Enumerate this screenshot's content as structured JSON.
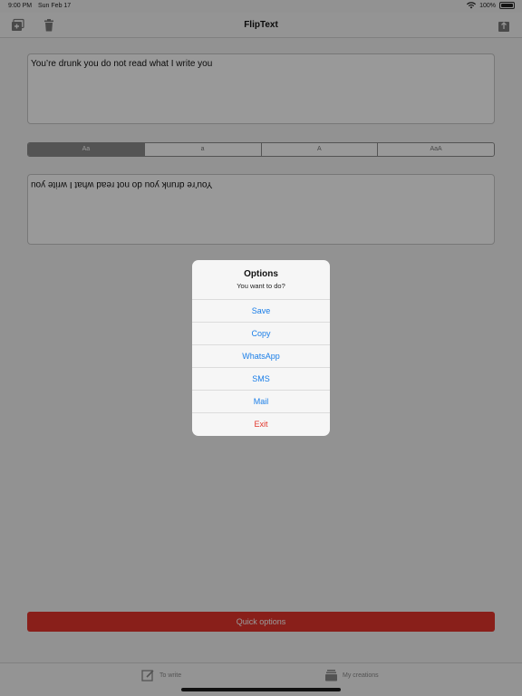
{
  "status_bar": {
    "time": "9:00 PM",
    "date": "Sun Feb 17",
    "battery": "100%"
  },
  "nav": {
    "title": "FlipText",
    "left_icons": [
      "add-icon",
      "trash-icon"
    ],
    "right_icon": "share-icon"
  },
  "input_text": "You’re drunk you do not read what I write you",
  "case_options": [
    "Aa",
    "a",
    "A",
    "AaA"
  ],
  "selected_case": 0,
  "output_text": "You’re drunk you do not read what I write you",
  "quick_options_label": "Quick options",
  "tabs": [
    {
      "label": "To write",
      "icon": "compose-icon"
    },
    {
      "label": "My creations",
      "icon": "stack-icon"
    }
  ],
  "dialog": {
    "title": "Options",
    "message": "You want to do?",
    "actions": [
      {
        "label": "Save",
        "style": "default"
      },
      {
        "label": "Copy",
        "style": "default"
      },
      {
        "label": "WhatsApp",
        "style": "default"
      },
      {
        "label": "SMS",
        "style": "default"
      },
      {
        "label": "Mail",
        "style": "default"
      },
      {
        "label": "Exit",
        "style": "destructive"
      }
    ]
  },
  "colors": {
    "accent": "#1a7ee8",
    "destructive": "#e2352b",
    "quick_button": "#e5352c"
  }
}
